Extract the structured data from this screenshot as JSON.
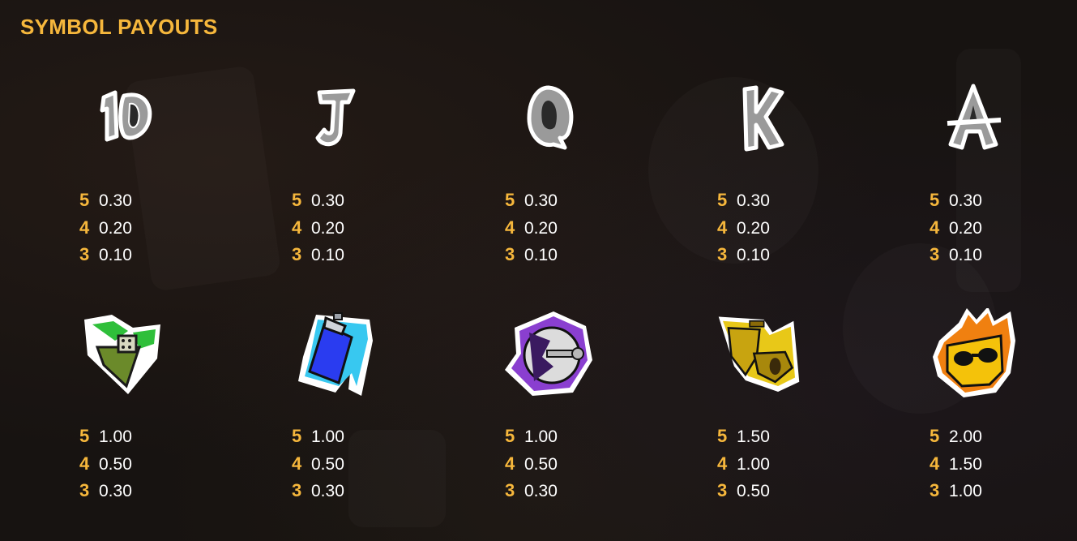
{
  "title": "SYMBOL PAYOUTS",
  "colors": {
    "accent": "#f6b73c",
    "text": "#ffffff",
    "background": "#171311"
  },
  "symbols": [
    {
      "name": "10",
      "icon": "graffiti-10-icon",
      "payouts": [
        {
          "count": "5",
          "value": "0.30"
        },
        {
          "count": "4",
          "value": "0.20"
        },
        {
          "count": "3",
          "value": "0.10"
        }
      ]
    },
    {
      "name": "J",
      "icon": "graffiti-j-icon",
      "payouts": [
        {
          "count": "5",
          "value": "0.30"
        },
        {
          "count": "4",
          "value": "0.20"
        },
        {
          "count": "3",
          "value": "0.10"
        }
      ]
    },
    {
      "name": "Q",
      "icon": "graffiti-q-icon",
      "payouts": [
        {
          "count": "5",
          "value": "0.30"
        },
        {
          "count": "4",
          "value": "0.20"
        },
        {
          "count": "3",
          "value": "0.10"
        }
      ]
    },
    {
      "name": "K",
      "icon": "graffiti-k-icon",
      "payouts": [
        {
          "count": "5",
          "value": "0.30"
        },
        {
          "count": "4",
          "value": "0.20"
        },
        {
          "count": "3",
          "value": "0.10"
        }
      ]
    },
    {
      "name": "A",
      "icon": "graffiti-a-icon",
      "payouts": [
        {
          "count": "5",
          "value": "0.30"
        },
        {
          "count": "4",
          "value": "0.20"
        },
        {
          "count": "3",
          "value": "0.10"
        }
      ]
    },
    {
      "name": "lighter",
      "icon": "lighter-icon",
      "payouts": [
        {
          "count": "5",
          "value": "1.00"
        },
        {
          "count": "4",
          "value": "0.50"
        },
        {
          "count": "3",
          "value": "0.30"
        }
      ]
    },
    {
      "name": "spray-can",
      "icon": "spray-can-icon",
      "payouts": [
        {
          "count": "5",
          "value": "1.00"
        },
        {
          "count": "4",
          "value": "0.50"
        },
        {
          "count": "3",
          "value": "0.30"
        }
      ]
    },
    {
      "name": "skateboard",
      "icon": "skateboard-icon",
      "payouts": [
        {
          "count": "5",
          "value": "1.00"
        },
        {
          "count": "4",
          "value": "0.50"
        },
        {
          "count": "3",
          "value": "0.30"
        }
      ]
    },
    {
      "name": "boombox",
      "icon": "boombox-icon",
      "payouts": [
        {
          "count": "5",
          "value": "1.50"
        },
        {
          "count": "4",
          "value": "1.00"
        },
        {
          "count": "3",
          "value": "0.50"
        }
      ]
    },
    {
      "name": "skull",
      "icon": "flaming-skull-icon",
      "payouts": [
        {
          "count": "5",
          "value": "2.00"
        },
        {
          "count": "4",
          "value": "1.50"
        },
        {
          "count": "3",
          "value": "1.00"
        }
      ]
    }
  ]
}
